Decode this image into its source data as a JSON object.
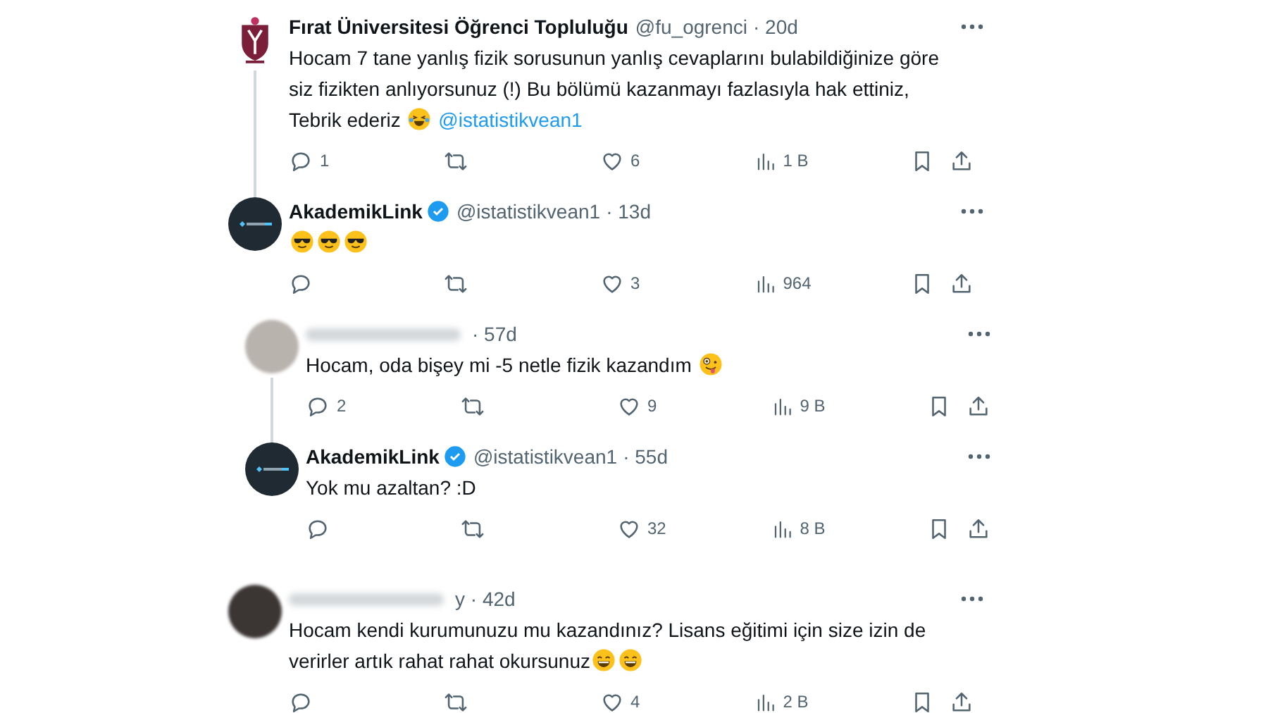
{
  "tweets": [
    {
      "avatar": {
        "kind": "crest"
      },
      "name": "Fırat Üniversitesi Öğrenci Topluluğu",
      "verified": false,
      "name_blurred": false,
      "handle": "@fu_ogrenci",
      "time": "· 20d",
      "connector": true,
      "body": [
        {
          "kind": "text",
          "text": "Hocam 7 tane yanlış fizik sorusunun yanlış cevaplarını bulabildiğinize göre siz fizikten anlıyorsunuz (!) Bu bölümü kazanmayı fazlasıyla hak ettiniz, Tebrik ederiz "
        },
        {
          "kind": "emoji-laugh"
        },
        {
          "kind": "mention",
          "text": " @istatistikvean1"
        }
      ],
      "replies": "1",
      "likes": "6",
      "views": "1 B"
    },
    {
      "avatar": {
        "kind": "logo"
      },
      "name": "AkademikLink",
      "verified": true,
      "name_blurred": false,
      "handle": "@istatistikvean1",
      "time": "· 13d",
      "connector": false,
      "body": [
        {
          "kind": "emoji-cool"
        },
        {
          "kind": "emoji-cool"
        },
        {
          "kind": "emoji-cool"
        }
      ],
      "likes": "3",
      "views": "964",
      "children": [
        {
          "avatar": {
            "kind": "blurred"
          },
          "name_blurred": true,
          "verified": false,
          "time": "· 57d",
          "connector": true,
          "body": [
            {
              "kind": "text",
              "text": "Hocam, oda bişey mi -5 netle fizik kazandım "
            },
            {
              "kind": "emoji-zany"
            }
          ],
          "replies": "2",
          "likes": "9",
          "views": "9 B"
        },
        {
          "avatar": {
            "kind": "logo"
          },
          "name": "AkademikLink",
          "verified": true,
          "name_blurred": false,
          "handle": "@istatistikvean1",
          "time": "· 55d",
          "connector": false,
          "body": [
            {
              "kind": "text",
              "text": "Yok mu azaltan? :D"
            }
          ],
          "likes": "32",
          "views": "8 B"
        }
      ]
    },
    {
      "avatar": {
        "kind": "blurred-dark"
      },
      "name_blurred": true,
      "verified": false,
      "time": "y · 42d",
      "connector": false,
      "body": [
        {
          "kind": "text",
          "text": "Hocam kendi kurumunuzu mu kazandınız? Lisans eğitimi için size izin de verirler artık rahat rahat okursunuz"
        },
        {
          "kind": "emoji-grin"
        },
        {
          "kind": "emoji-grin"
        }
      ],
      "likes": "4",
      "views": "2 B"
    }
  ]
}
